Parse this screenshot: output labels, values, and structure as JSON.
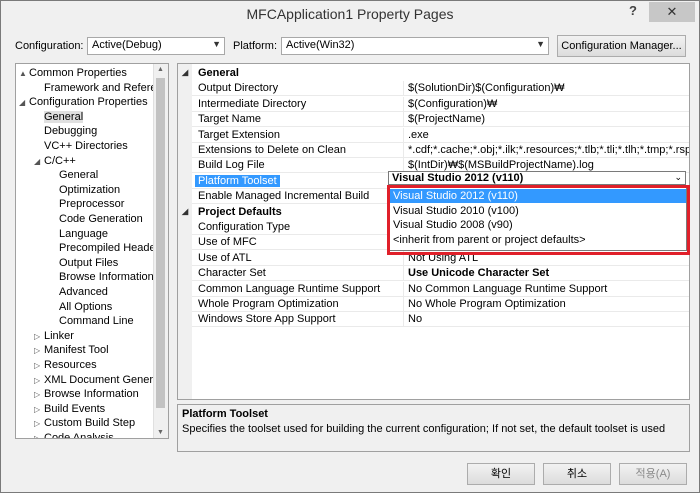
{
  "window": {
    "title": "MFCApplication1 Property Pages",
    "help": "?",
    "close": "✕"
  },
  "top": {
    "configuration_label": "Configuration:",
    "configuration_value": "Active(Debug)",
    "platform_label": "Platform:",
    "platform_value": "Active(Win32)",
    "config_manager_button": "Configuration Manager..."
  },
  "tree": [
    {
      "label": "Common Properties",
      "toggle": "▲",
      "indent": 0
    },
    {
      "label": "Framework and References",
      "toggle": "",
      "indent": 1
    },
    {
      "label": "Configuration Properties",
      "toggle": "◢",
      "indent": 0
    },
    {
      "label": "General",
      "toggle": "",
      "indent": 1,
      "selected": true
    },
    {
      "label": "Debugging",
      "toggle": "",
      "indent": 1
    },
    {
      "label": "VC++ Directories",
      "toggle": "",
      "indent": 1
    },
    {
      "label": "C/C++",
      "toggle": "◢",
      "indent": 1
    },
    {
      "label": "General",
      "toggle": "",
      "indent": 2
    },
    {
      "label": "Optimization",
      "toggle": "",
      "indent": 2
    },
    {
      "label": "Preprocessor",
      "toggle": "",
      "indent": 2
    },
    {
      "label": "Code Generation",
      "toggle": "",
      "indent": 2
    },
    {
      "label": "Language",
      "toggle": "",
      "indent": 2
    },
    {
      "label": "Precompiled Headers",
      "toggle": "",
      "indent": 2
    },
    {
      "label": "Output Files",
      "toggle": "",
      "indent": 2
    },
    {
      "label": "Browse Information",
      "toggle": "",
      "indent": 2
    },
    {
      "label": "Advanced",
      "toggle": "",
      "indent": 2
    },
    {
      "label": "All Options",
      "toggle": "",
      "indent": 2
    },
    {
      "label": "Command Line",
      "toggle": "",
      "indent": 2
    },
    {
      "label": "Linker",
      "toggle": "▷",
      "indent": 1
    },
    {
      "label": "Manifest Tool",
      "toggle": "▷",
      "indent": 1
    },
    {
      "label": "Resources",
      "toggle": "▷",
      "indent": 1
    },
    {
      "label": "XML Document Generator",
      "toggle": "▷",
      "indent": 1
    },
    {
      "label": "Browse Information",
      "toggle": "▷",
      "indent": 1
    },
    {
      "label": "Build Events",
      "toggle": "▷",
      "indent": 1
    },
    {
      "label": "Custom Build Step",
      "toggle": "▷",
      "indent": 1
    },
    {
      "label": "Code Analysis",
      "toggle": "▷",
      "indent": 1
    }
  ],
  "grid": {
    "general_label": "General",
    "general_toggle": "◢",
    "general_rows": [
      {
        "name": "Output Directory",
        "value": "$(SolutionDir)$(Configuration)₩"
      },
      {
        "name": "Intermediate Directory",
        "value": "$(Configuration)₩"
      },
      {
        "name": "Target Name",
        "value": "$(ProjectName)"
      },
      {
        "name": "Target Extension",
        "value": ".exe"
      },
      {
        "name": "Extensions to Delete on Clean",
        "value": "*.cdf;*.cache;*.obj;*.ilk;*.resources;*.tlb;*.tli;*.tlh;*.tmp;*.rsp;*.pgc;*.pgd"
      },
      {
        "name": "Build Log File",
        "value": "$(IntDir)₩$(MSBuildProjectName).log"
      },
      {
        "name": "Platform Toolset",
        "value": "Visual Studio 2012 (v110)"
      },
      {
        "name": "Enable Managed Incremental Build",
        "value": ""
      }
    ],
    "defaults_label": "Project Defaults",
    "defaults_toggle": "◢",
    "defaults_rows": [
      {
        "name": "Configuration Type",
        "value": ""
      },
      {
        "name": "Use of MFC",
        "value": ""
      },
      {
        "name": "Use of ATL",
        "value": "Not Using ATL"
      },
      {
        "name": "Character Set",
        "value": "Use Unicode Character Set",
        "bold": true
      },
      {
        "name": "Common Language Runtime Support",
        "value": "No Common Language Runtime Support"
      },
      {
        "name": "Whole Program Optimization",
        "value": "No Whole Program Optimization"
      },
      {
        "name": "Windows Store App Support",
        "value": "No"
      }
    ]
  },
  "dropdown": {
    "current": "Visual Studio 2012 (v110)",
    "options": [
      "Visual Studio 2012 (v110)",
      "Visual Studio 2010 (v100)",
      "Visual Studio 2008 (v90)",
      "<inherit from parent or project defaults>"
    ],
    "highlight_color": "#3399ff",
    "box_color": "#e0202a"
  },
  "description": {
    "title": "Platform Toolset",
    "text": "Specifies the toolset used for building the current configuration; If not set, the default toolset is used"
  },
  "buttons": {
    "ok": "확인",
    "cancel": "취소",
    "apply": "적용(A)"
  }
}
